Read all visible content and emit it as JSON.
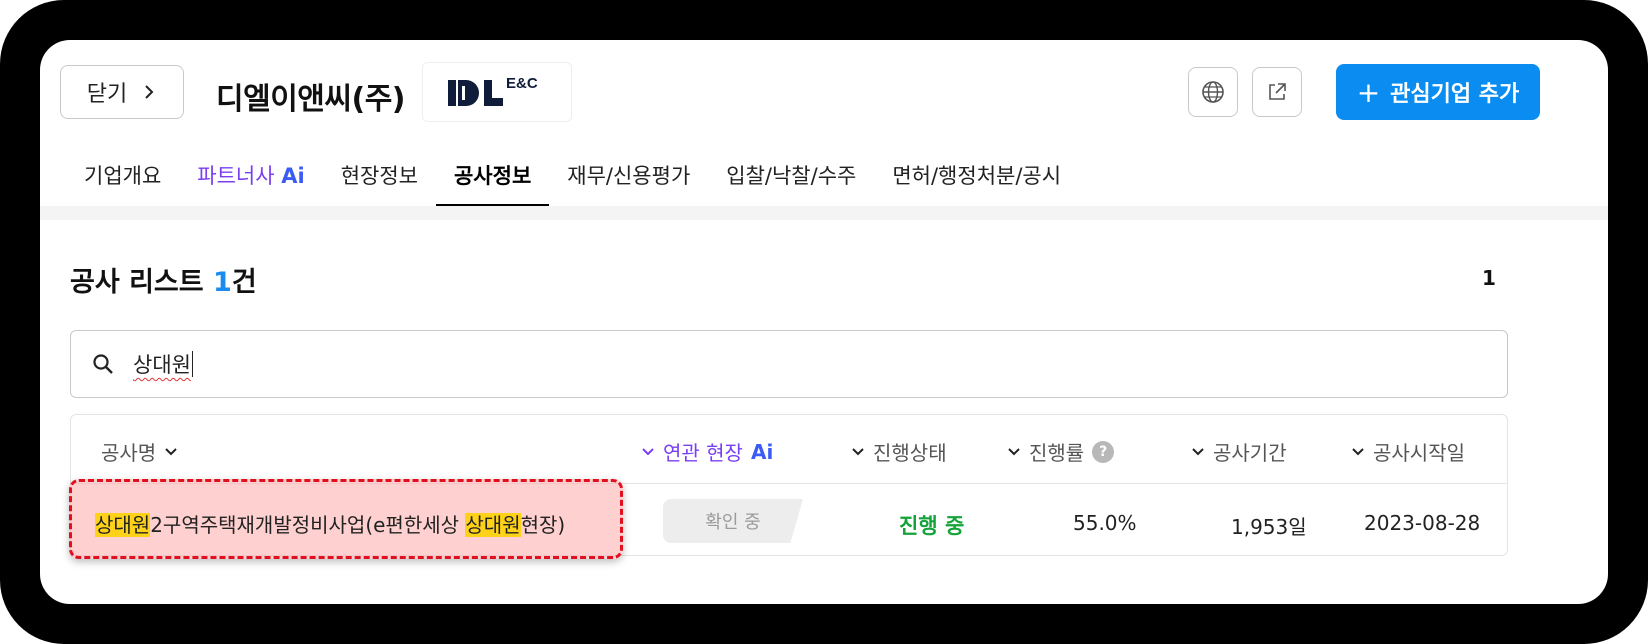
{
  "header": {
    "close_label": "닫기",
    "company_name": "디엘이앤씨(주)",
    "logo": {
      "main": "DL",
      "sup": "E&C",
      "color": "#0f1d3a"
    },
    "add_button_label": "관심기업 추가",
    "add_button_icon": "+"
  },
  "tabs": [
    {
      "label": "기업개요"
    },
    {
      "label": "파트너사",
      "suffix": "Ai"
    },
    {
      "label": "현장정보"
    },
    {
      "label": "공사정보",
      "active": true
    },
    {
      "label": "재무/신용평가"
    },
    {
      "label": "입찰/낙찰/수주"
    },
    {
      "label": "면허/행정처분/공시"
    }
  ],
  "list": {
    "title": "공사 리스트",
    "count": "1",
    "count_unit": "건",
    "page": "1"
  },
  "search": {
    "value": "상대원"
  },
  "table": {
    "columns": {
      "name": "공사명",
      "related": "연관 현장",
      "related_suffix": "Ai",
      "status": "진행상태",
      "rate": "진행률",
      "rate_help": "?",
      "period": "공사기간",
      "start": "공사시작일"
    },
    "rows": [
      {
        "name_parts": [
          "상대원",
          "2구역주택재개발정비사업(e편한세상 ",
          "상대원",
          "현장)"
        ],
        "related_status": "확인 중",
        "status": "진행 중",
        "rate": "55.0%",
        "period": "1,953일",
        "start": "2023-08-28"
      }
    ]
  },
  "colors": {
    "accent": "#0a8cf0",
    "ai_purple": "#7b3ff2",
    "status_green": "#14a43a",
    "highlight": "#ffd21a",
    "annotation_red": "#e0101e"
  }
}
